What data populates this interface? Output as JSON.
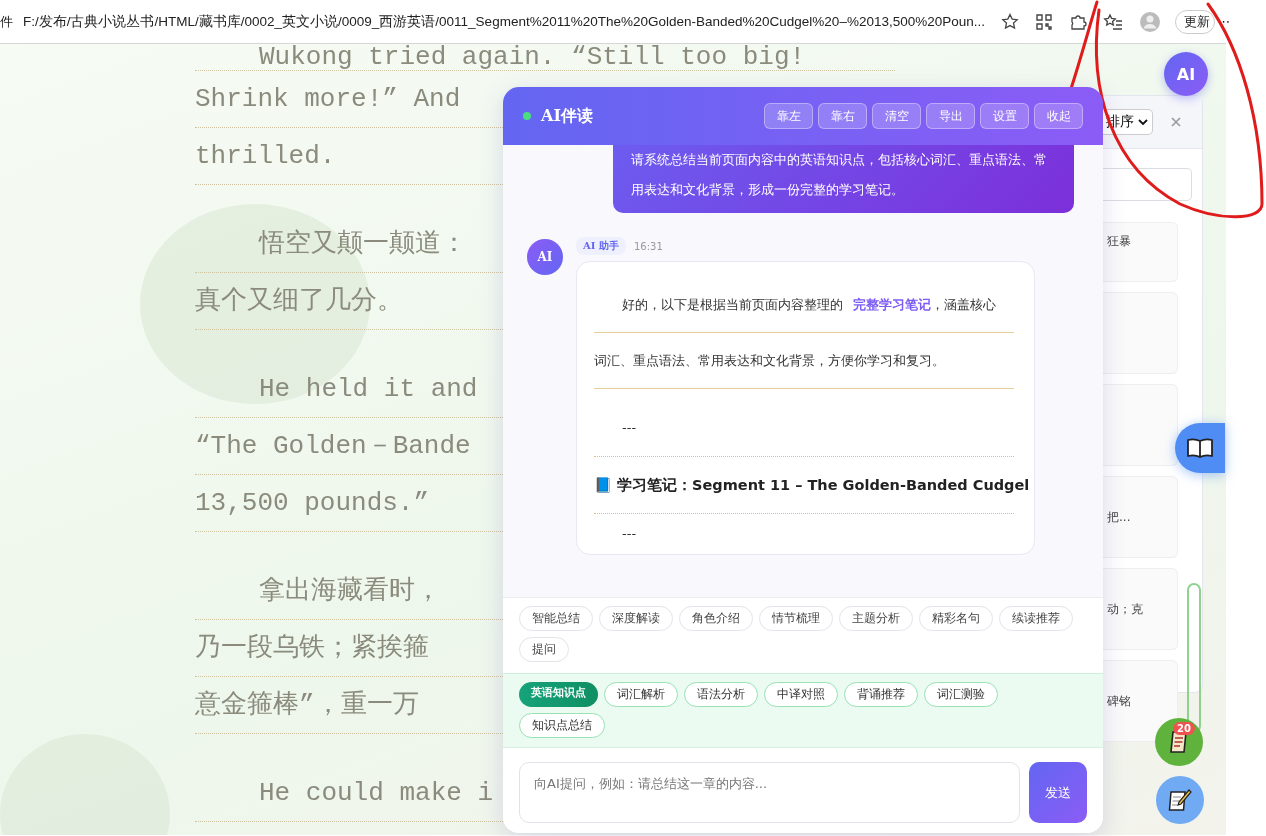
{
  "browser": {
    "tab_fragment": "件",
    "url": "F:/发布/古典小说丛书/HTML/藏书库/0002_英文小说/0009_西游英语/0011_Segment%2011%20The%20Golden-Banded%20Cudgel%20–%2013,500%20Poun...",
    "update_button": "更新",
    "more_button": "⋯"
  },
  "reading": {
    "paragraphs": [
      {
        "lines": [
          "Wukong tried again. “Still too big!",
          "Shrink more!” And",
          "thrilled."
        ]
      },
      {
        "lines": [
          "悟空又颠一颠道：",
          "真个又细了几分。"
        ]
      },
      {
        "lines": [
          "He held it and",
          "“The Golden－Bande",
          "13,500 pounds.”"
        ]
      },
      {
        "lines": [
          "拿出海藏看时，",
          "乃一段乌铁；紧挨箍",
          "意金箍棒”，重一万"
        ]
      },
      {
        "lines": [
          "He could make i"
        ]
      }
    ]
  },
  "chat": {
    "title": "AI伴读",
    "online": true,
    "header_buttons": [
      "靠左",
      "靠右",
      "清空",
      "导出",
      "设置",
      "收起"
    ],
    "messages": [
      {
        "kind": "user",
        "text": "请系统总结当前页面内容中的英语知识点，包括核心词汇、重点语法、常用表达和文化背景，形成一份完整的学习笔记。"
      },
      {
        "kind": "assistant",
        "avatar": "AI",
        "sender": "AI 助手",
        "time": "16:31",
        "blocks": [
          {
            "kind": "paragraph",
            "text": "好的，以下是根据当前页面内容整理的 **完整学习笔记**，涵盖核心词汇、重点语法、常用表达和文化背景，方便你学习和复习。"
          },
          {
            "kind": "rule",
            "text": "---"
          },
          {
            "kind": "heading",
            "text": "📘 学习笔记：Segment 11 – The Golden-Banded Cudgel"
          },
          {
            "kind": "rule",
            "text": "---"
          }
        ]
      }
    ],
    "quick_actions": [
      "智能总结",
      "深度解读",
      "角色介绍",
      "情节梳理",
      "主题分析",
      "精彩名句",
      "续读推荐",
      "提问"
    ],
    "english": {
      "label": "英语知识点",
      "chips": [
        "词汇解析",
        "语法分析",
        "中译对照",
        "背诵推荐",
        "词汇测验",
        "知识点总结"
      ]
    },
    "input": {
      "placeholder": "向AI提问，例如：请总结这一章的内容..."
    },
    "send_button": "发送"
  },
  "side_panel": {
    "sort_select": "排序",
    "cards": [
      {
        "kind": "text",
        "snippet": "狂暴"
      },
      {
        "kind": "blank"
      },
      {
        "kind": "blank"
      },
      {
        "kind": "text",
        "snippet": "把..."
      },
      {
        "kind": "text",
        "snippet": "动；克"
      },
      {
        "kind": "text",
        "snippet": "碑铭"
      }
    ]
  },
  "floating": {
    "ai_button": "AI",
    "notes_badge": "20"
  }
}
